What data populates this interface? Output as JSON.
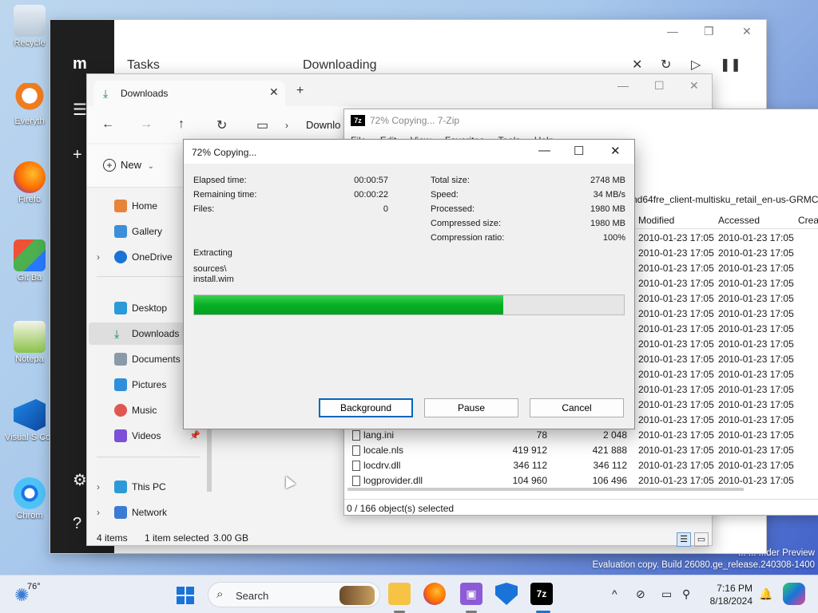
{
  "desktop": {
    "icons": [
      "Recycle",
      "Everyth",
      "Firefo",
      "Git Ba",
      "Notepa",
      "Visual S Cod",
      "Chrom"
    ]
  },
  "tasks_window": {
    "title": "Tasks",
    "header": "Downloading"
  },
  "explorer": {
    "tab_title": "Downloads",
    "breadcrumb": "Downlo",
    "new_label": "New",
    "nav": {
      "home": "Home",
      "gallery": "Gallery",
      "onedrive": "OneDrive",
      "desktop": "Desktop",
      "downloads": "Downloads",
      "documents": "Documents",
      "pictures": "Pictures",
      "music": "Music",
      "videos": "Videos",
      "thispc": "This PC",
      "network": "Network"
    },
    "status": {
      "items": "4 items",
      "selected": "1 item selected",
      "size": "3.00 GB"
    }
  },
  "sevenzip": {
    "title": "72% Copying... 7-Zip",
    "menu": [
      "File",
      "Edit",
      "View",
      "Favorites",
      "Tools",
      "Help"
    ],
    "path": "nd64fre_client-multisku_retail_en-us-GRMCX",
    "columns": {
      "modified": "Modified",
      "accessed": "Accessed",
      "created": "Creat"
    },
    "date_rows": [
      {
        "modified": "2010-01-23 17:05",
        "accessed": "2010-01-23 17:05"
      },
      {
        "modified": "2010-01-23 17:05",
        "accessed": "2010-01-23 17:05"
      },
      {
        "modified": "2010-01-23 17:05",
        "accessed": "2010-01-23 17:05"
      },
      {
        "modified": "2010-01-23 17:05",
        "accessed": "2010-01-23 17:05"
      },
      {
        "modified": "2010-01-23 17:05",
        "accessed": "2010-01-23 17:05"
      },
      {
        "modified": "2010-01-23 17:05",
        "accessed": "2010-01-23 17:05"
      },
      {
        "modified": "2010-01-23 17:05",
        "accessed": "2010-01-23 17:05"
      },
      {
        "modified": "2010-01-23 17:05",
        "accessed": "2010-01-23 17:05"
      },
      {
        "modified": "2010-01-23 17:05",
        "accessed": "2010-01-23 17:05"
      },
      {
        "modified": "2010-01-23 17:05",
        "accessed": "2010-01-23 17:05"
      },
      {
        "modified": "2010-01-23 17:05",
        "accessed": "2010-01-23 17:05"
      },
      {
        "modified": "2010-01-23 17:05",
        "accessed": "2010-01-23 17:05"
      },
      {
        "modified": "2010-01-23 17:05",
        "accessed": "2010-01-23 17:05"
      }
    ],
    "file_rows": [
      {
        "name": "lang.ini",
        "size": "78",
        "packed": "2 048",
        "modified": "2010-01-23 17:05",
        "accessed": "2010-01-23 17:05"
      },
      {
        "name": "locale.nls",
        "size": "419 912",
        "packed": "421 888",
        "modified": "2010-01-23 17:05",
        "accessed": "2010-01-23 17:05"
      },
      {
        "name": "locdrv.dll",
        "size": "346 112",
        "packed": "346 112",
        "modified": "2010-01-23 17:05",
        "accessed": "2010-01-23 17:05"
      },
      {
        "name": "logprovider.dll",
        "size": "104 960",
        "packed": "106 496",
        "modified": "2010-01-23 17:05",
        "accessed": "2010-01-23 17:05"
      }
    ],
    "status": "0 / 166 object(s) selected"
  },
  "copy_dialog": {
    "title": "72% Copying...",
    "left": {
      "elapsed_label": "Elapsed time:",
      "elapsed": "00:00:57",
      "remaining_label": "Remaining time:",
      "remaining": "00:00:22",
      "files_label": "Files:",
      "files": "0"
    },
    "right": {
      "total_label": "Total size:",
      "total": "2748 MB",
      "speed_label": "Speed:",
      "speed": "34 MB/s",
      "processed_label": "Processed:",
      "processed": "1980 MB",
      "compressed_label": "Compressed size:",
      "compressed": "1980 MB",
      "ratio_label": "Compression ratio:",
      "ratio": "100%"
    },
    "operation": "Extracting",
    "folder": "sources\\",
    "file": "install.wim",
    "progress": 0.72,
    "buttons": {
      "background": "Background",
      "pause": "Pause",
      "cancel": "Cancel"
    }
  },
  "watermark": {
    "line1": "... ... ...der Preview",
    "line2": "Evaluation copy. Build 26080.ge_release.240308-1400"
  },
  "taskbar": {
    "weather_temp": "76°",
    "search_placeholder": "Search",
    "time": "7:16 PM",
    "date": "8/18/2024"
  },
  "colors": {
    "progress_green": "#06b025",
    "accent": "#0067c0",
    "taskbar_bg": "#e9eef6"
  }
}
